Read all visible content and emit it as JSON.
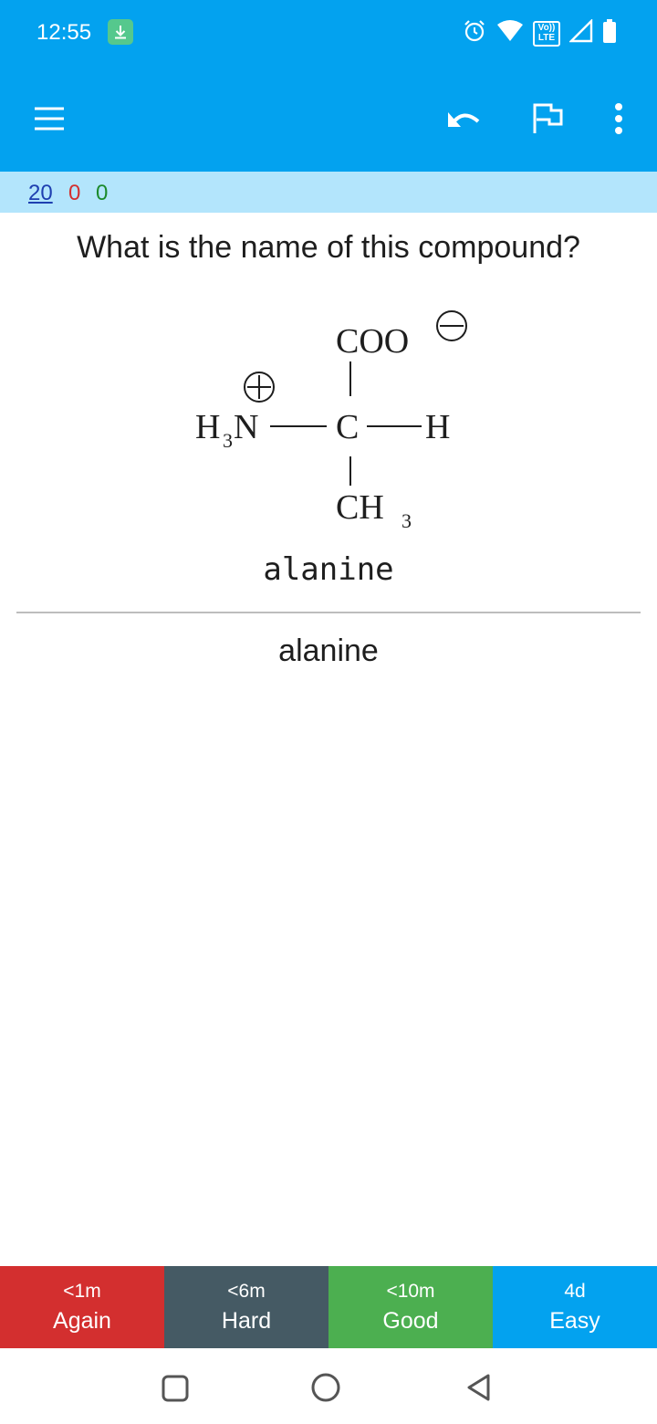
{
  "status_bar": {
    "time": "12:55",
    "volte_label_top": "Vo))",
    "volte_label_bottom": "LTE"
  },
  "toolbar": {
    "menu_icon": "hamburger-icon",
    "undo_icon": "undo-icon",
    "flag_icon": "flag-icon",
    "more_icon": "more-vert-icon"
  },
  "counts": {
    "new": "20",
    "learning": "0",
    "review": "0",
    "colors": {
      "new": "#1e3fb0",
      "learning": "#d32f2f",
      "review": "#1b8a2c"
    }
  },
  "card": {
    "question": "What is the name of this compound?",
    "structure": {
      "top_group": "COO",
      "top_charge": "⊖",
      "left_group": "H",
      "left_sub": "3",
      "left_atom": "N",
      "left_charge": "⊕",
      "center_atom": "C",
      "right_group": "H",
      "bottom_group": "CH",
      "bottom_sub": "3"
    },
    "typed_answer": "alanine",
    "answer": "alanine"
  },
  "answer_buttons": [
    {
      "interval": "<1m",
      "label": "Again",
      "color": "#d32f2f"
    },
    {
      "interval": "<6m",
      "label": "Hard",
      "color": "#455a64"
    },
    {
      "interval": "<10m",
      "label": "Good",
      "color": "#4caf50"
    },
    {
      "interval": "4d",
      "label": "Easy",
      "color": "#03a2ef"
    }
  ],
  "nav_bar": {
    "recents_icon": "recents-square-icon",
    "home_icon": "home-circle-icon",
    "back_icon": "back-triangle-icon"
  }
}
